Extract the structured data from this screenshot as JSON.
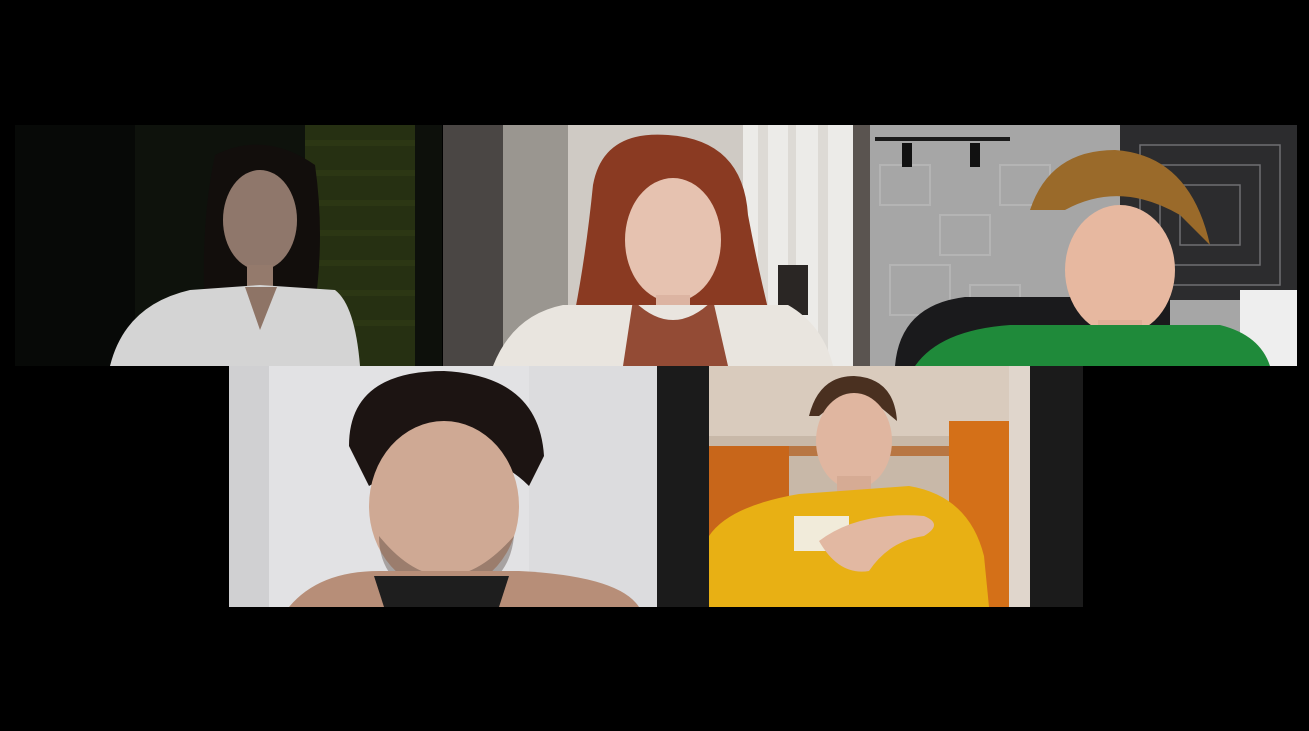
{
  "meeting": {
    "layout": "gallery",
    "participant_count": 5,
    "background_color": "#000000"
  },
  "participants": [
    {
      "tile": 1,
      "video_on": true,
      "scene": "dark-room",
      "shirt_color": "#d8d8d8",
      "hair_color": "#1a1210"
    },
    {
      "tile": 2,
      "video_on": true,
      "scene": "curtain-window",
      "shirt_color": "#eae6e0",
      "hair_color": "#8a3a22"
    },
    {
      "tile": 3,
      "video_on": true,
      "scene": "gray-wall-poster",
      "shirt_color": "#1f8a3a",
      "hair_color": "#9a6a2a"
    },
    {
      "tile": 4,
      "video_on": true,
      "scene": "white-wall",
      "shirt_color": "#1e1e1e",
      "hair_color": "#1c1412"
    },
    {
      "tile": 5,
      "video_on": true,
      "scene": "orange-wardrobe",
      "shirt_color": "#e8b014",
      "hair_color": "#4a3020"
    }
  ]
}
